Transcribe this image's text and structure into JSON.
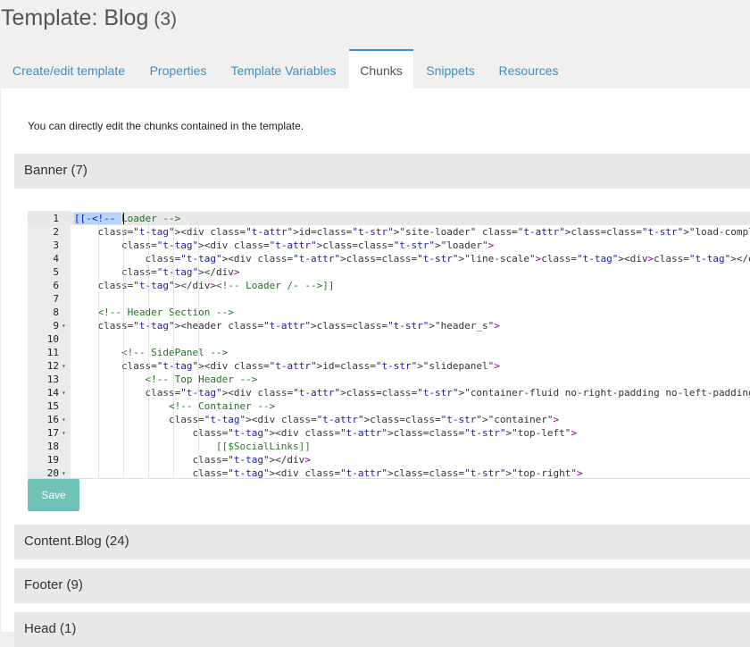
{
  "page": {
    "title": "Template: Blog",
    "count": "(3)"
  },
  "tabs": [
    {
      "label": "Create/edit template",
      "active": false
    },
    {
      "label": "Properties",
      "active": false
    },
    {
      "label": "Template Variables",
      "active": false
    },
    {
      "label": "Chunks",
      "active": true
    },
    {
      "label": "Snippets",
      "active": false
    },
    {
      "label": "Resources",
      "active": false
    }
  ],
  "intro": "You can directly edit the chunks contained in the template.",
  "chunks": [
    {
      "label": "Banner (7)"
    },
    {
      "label": "Content.Blog (24)"
    },
    {
      "label": "Footer (9)"
    },
    {
      "label": "Head (1)"
    }
  ],
  "editor": {
    "lines": [
      {
        "n": "1",
        "fold": false,
        "code": "[[-<!-- Loader -->"
      },
      {
        "n": "2",
        "fold": false,
        "code": "    <div id=\"site-loader\" class=\"load-complete\">"
      },
      {
        "n": "3",
        "fold": false,
        "code": "        <div class=\"loader\">"
      },
      {
        "n": "4",
        "fold": false,
        "code": "            <div class=\"line-scale\"><div></div><div></div><div></div><div></div><div></div></div>"
      },
      {
        "n": "5",
        "fold": false,
        "code": "        </div>"
      },
      {
        "n": "6",
        "fold": false,
        "code": "    </div><!-- Loader /- -->]]"
      },
      {
        "n": "7",
        "fold": false,
        "code": ""
      },
      {
        "n": "8",
        "fold": false,
        "code": "    <!-- Header Section -->"
      },
      {
        "n": "9",
        "fold": true,
        "code": "    <header class=\"header_s\">"
      },
      {
        "n": "10",
        "fold": false,
        "code": ""
      },
      {
        "n": "11",
        "fold": false,
        "code": "        <!-- SidePanel -->"
      },
      {
        "n": "12",
        "fold": true,
        "code": "        <div id=\"slidepanel\">"
      },
      {
        "n": "13",
        "fold": false,
        "code": "            <!-- Top Header -->"
      },
      {
        "n": "14",
        "fold": true,
        "code": "            <div class=\"container-fluid no-right-padding no-left-padding top-header\">"
      },
      {
        "n": "15",
        "fold": false,
        "code": "                <!-- Container -->"
      },
      {
        "n": "16",
        "fold": true,
        "code": "                <div class=\"container\">"
      },
      {
        "n": "17",
        "fold": true,
        "code": "                    <div class=\"top-left\">"
      },
      {
        "n": "18",
        "fold": false,
        "code": "                        [[$SocialLinks]]"
      },
      {
        "n": "19",
        "fold": false,
        "code": "                    </div>"
      },
      {
        "n": "20",
        "fold": true,
        "code": "                    <div class=\"top-right\">"
      }
    ]
  },
  "save_label": "Save",
  "colors": {
    "accent": "#3d8ec4",
    "save": "#6ec3b6",
    "tag": "#920092",
    "string": "#1a1aa6",
    "comment": "#236e24"
  }
}
